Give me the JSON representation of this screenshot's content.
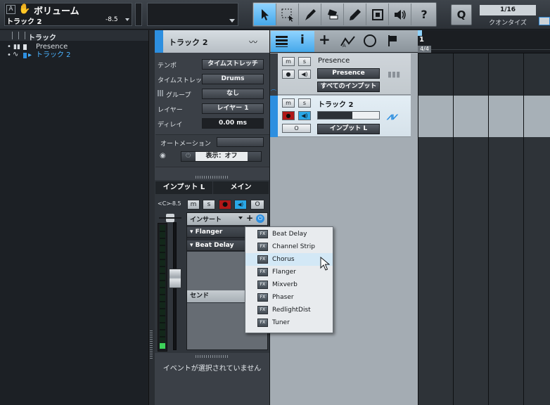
{
  "toolbar": {
    "info_icon_letter": "A",
    "param_name": "ボリューム",
    "track_name": "トラック 2",
    "param_value": "-8.5",
    "tools": [
      "arrow-tool",
      "range-tool",
      "split-tool",
      "eraser-tool",
      "paint-tool",
      "mute-tool",
      "listen-tool",
      "help"
    ],
    "quantize_value": "1/16",
    "quantize_label": "クオンタイズ",
    "accent": "#45a8ea"
  },
  "browser": {
    "header": "トラック",
    "rows": [
      {
        "name": "Presence"
      },
      {
        "name": "トラック 2"
      }
    ]
  },
  "inspector": {
    "title": "トラック 2",
    "props": [
      {
        "label": "テンポ",
        "value": "タイムストレッチ"
      },
      {
        "label": "タイムストレッチ",
        "value": "Drums"
      },
      {
        "label": "グループ",
        "value": "なし"
      },
      {
        "label": "レイヤー",
        "value": "レイヤー 1"
      },
      {
        "label": "ディレイ",
        "value": "0.00 ms"
      }
    ],
    "automation_label": "オートメーション",
    "display_value": "表示：オフ",
    "channel": {
      "input_tab": "インプット L",
      "main_tab": "メイン",
      "pan": "<C>",
      "volume": "-8.5",
      "buttons": [
        "m",
        "s",
        "●",
        "◀)",
        "O"
      ],
      "inserts_label": "インサート",
      "inserts": [
        "Flanger",
        "Beat Delay"
      ],
      "sends_label": "センド"
    },
    "no_event": "イベントが選択されていません"
  },
  "tracks": [
    {
      "name": "Presence",
      "instrument": "Presence",
      "input": "すべてのインプット"
    },
    {
      "name": "トラック 2",
      "input": "インプット L",
      "selected": true
    }
  ],
  "arrange": {
    "bar": "1",
    "signature": "4/4"
  },
  "popup": {
    "items": [
      "Beat Delay",
      "Channel Strip",
      "Chorus",
      "Flanger",
      "Mixverb",
      "Phaser",
      "RedlightDist",
      "Tuner"
    ],
    "highlighted": "Chorus",
    "fx_tag": "FX"
  }
}
